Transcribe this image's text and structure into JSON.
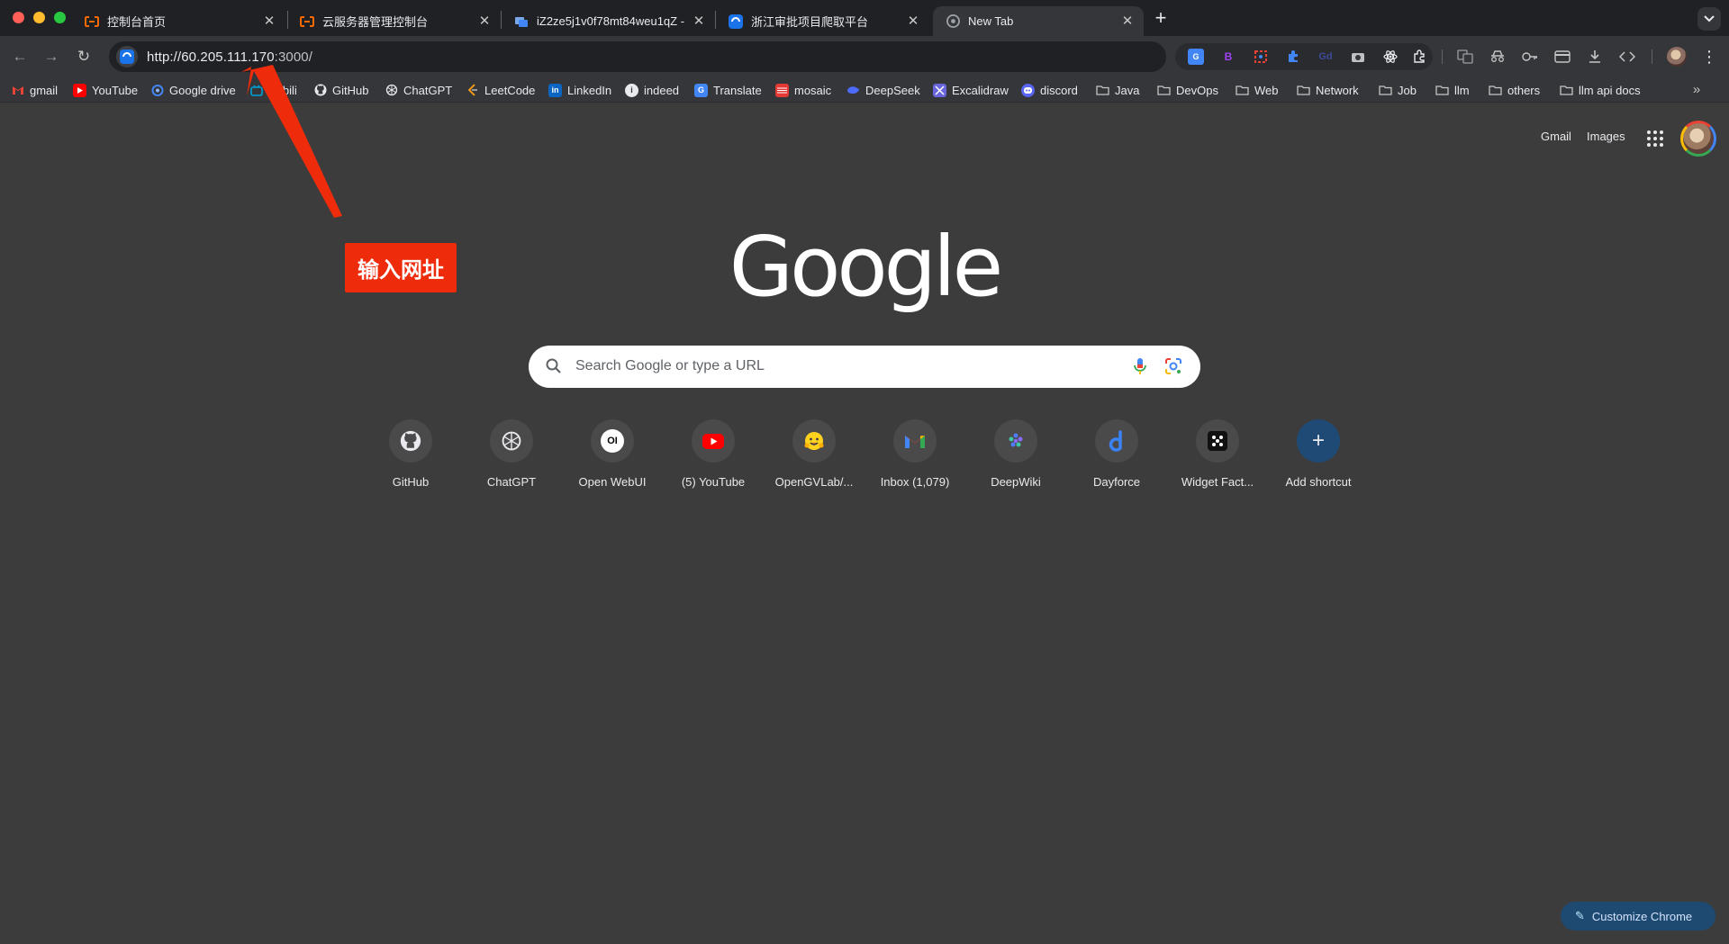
{
  "window": {
    "tabs": [
      {
        "title": "控制台首页",
        "icon": "aliyun-icon",
        "color": "#ff6a00",
        "active": false
      },
      {
        "title": "云服务器管理控制台",
        "icon": "aliyun-icon",
        "color": "#ff6a00",
        "active": false
      },
      {
        "title": "iZ2ze5j1v0f78mt84weu1qZ -",
        "icon": "terminal-icon",
        "color": "#4285f4",
        "active": false
      },
      {
        "title": "浙江审批项目爬取平台",
        "icon": "site-icon",
        "color": "#1a73e8",
        "active": false
      },
      {
        "title": "New Tab",
        "icon": "chrome-icon",
        "color": "#9aa0a6",
        "active": true
      }
    ],
    "new_tab_symbol": "+",
    "tab_close_symbol": "✕"
  },
  "toolbar": {
    "back_symbol": "←",
    "forward_symbol": "→",
    "reload_symbol": "↻",
    "url_host": "http://60.205.111.170",
    "url_rest": ":3000/"
  },
  "bookmarks": [
    {
      "label": "gmail",
      "icon": "gmail-icon"
    },
    {
      "label": "YouTube",
      "icon": "youtube-icon"
    },
    {
      "label": "Google drive",
      "icon": "drive-icon"
    },
    {
      "label": "bilibili",
      "icon": "bilibili-icon"
    },
    {
      "label": "GitHub",
      "icon": "github-icon"
    },
    {
      "label": "ChatGPT",
      "icon": "chatgpt-icon"
    },
    {
      "label": "LeetCode",
      "icon": "leetcode-icon"
    },
    {
      "label": "LinkedIn",
      "icon": "linkedin-icon"
    },
    {
      "label": "indeed",
      "icon": "indeed-icon"
    },
    {
      "label": "Translate",
      "icon": "translate-icon"
    },
    {
      "label": "mosaic",
      "icon": "mosaic-icon"
    },
    {
      "label": "DeepSeek",
      "icon": "deepseek-icon"
    },
    {
      "label": "Excalidraw",
      "icon": "excalidraw-icon"
    },
    {
      "label": "discord",
      "icon": "discord-icon"
    },
    {
      "label": "Java",
      "icon": "folder-icon"
    },
    {
      "label": "DevOps",
      "icon": "folder-icon"
    },
    {
      "label": "Web",
      "icon": "folder-icon"
    },
    {
      "label": "Network",
      "icon": "folder-icon"
    },
    {
      "label": "Job",
      "icon": "folder-icon"
    },
    {
      "label": "llm",
      "icon": "folder-icon"
    },
    {
      "label": "others",
      "icon": "folder-icon"
    },
    {
      "label": "llm api docs",
      "icon": "folder-icon"
    }
  ],
  "bookmarks_more_symbol": "»",
  "page": {
    "gmail_link": "Gmail",
    "images_link": "Images",
    "logo": "Google",
    "search_placeholder": "Search Google or type a URL",
    "shortcuts": [
      {
        "label": "GitHub",
        "icon": "github-icon"
      },
      {
        "label": "ChatGPT",
        "icon": "chatgpt-icon"
      },
      {
        "label": "Open WebUI",
        "icon": "openwebui-icon"
      },
      {
        "label": "(5) YouTube",
        "icon": "youtube-icon"
      },
      {
        "label": "OpenGVLab/...",
        "icon": "huggingface-icon"
      },
      {
        "label": "Inbox (1,079)",
        "icon": "gmail-icon"
      },
      {
        "label": "DeepWiki",
        "icon": "deepwiki-icon"
      },
      {
        "label": "Dayforce",
        "icon": "dayforce-icon"
      },
      {
        "label": "Widget Fact...",
        "icon": "widget-icon"
      },
      {
        "label": "Add shortcut",
        "icon": "plus-icon"
      }
    ],
    "customize_label": "Customize Chrome",
    "openwebui_glyph": "OI",
    "add_glyph": "+"
  },
  "annotation": {
    "label": "输入网址",
    "color": "#ee2c0c"
  }
}
